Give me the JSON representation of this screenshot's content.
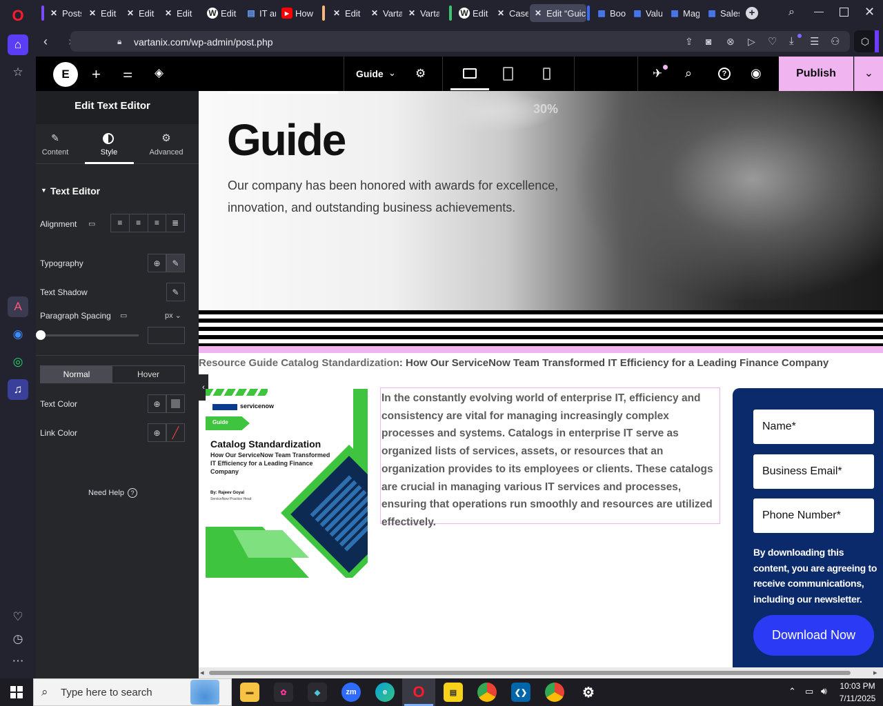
{
  "browser": {
    "tabs": [
      {
        "label": "Posts",
        "icon": "x-icon"
      },
      {
        "label": "Edit",
        "icon": "x-icon"
      },
      {
        "label": "Edit",
        "icon": "x-icon"
      },
      {
        "label": "Edit",
        "icon": "x-icon"
      },
      {
        "label": "Edit",
        "icon": "wordpress-icon"
      },
      {
        "label": "IT an",
        "icon": "page-icon"
      },
      {
        "label": "How",
        "icon": "youtube-icon"
      },
      {
        "label": "Edit",
        "icon": "x-icon"
      },
      {
        "label": "Varta",
        "icon": "x-icon"
      },
      {
        "label": "Varta",
        "icon": "x-icon"
      },
      {
        "label": "Edit",
        "icon": "wordpress-icon"
      },
      {
        "label": "Case",
        "icon": "x-icon"
      },
      {
        "label": "Edit “Guic",
        "icon": "x-icon"
      },
      {
        "label": "Boo",
        "icon": "page-icon"
      },
      {
        "label": "Valu",
        "icon": "page-icon"
      },
      {
        "label": "Mag",
        "icon": "page-icon"
      },
      {
        "label": "Sales",
        "icon": "page-icon"
      }
    ],
    "url": "vartanix.com/wp-admin/post.php"
  },
  "elementor": {
    "page_name": "Guide",
    "publish_label": "Publish"
  },
  "panel": {
    "title": "Edit Text Editor",
    "tabs": {
      "content": "Content",
      "style": "Style",
      "advanced": "Advanced"
    },
    "section_title": "Text Editor",
    "alignment_label": "Alignment",
    "typography_label": "Typography",
    "text_shadow_label": "Text Shadow",
    "paragraph_spacing_label": "Paragraph Spacing",
    "unit": "px",
    "normal_label": "Normal",
    "hover_label": "Hover",
    "text_color_label": "Text Color",
    "link_color_label": "Link Color",
    "need_help": "Need Help"
  },
  "page": {
    "hero_title": "Guide",
    "hero_text_line1": "Our company has been honored with awards for excellence,",
    "hero_text_line2": "innovation, and outstanding business achievements.",
    "hero_badge": "30%",
    "breadcrumb_prefix": "Resource Guide Catalog Standardization",
    "breadcrumb_rest": ": How Our ServiceNow Team Transformed IT Efficiency for a Leading Finance Company",
    "cover": {
      "brand": "servicenow",
      "tag": "Guide",
      "title": "Catalog Standardization",
      "subtitle_line1": "How Our ServiceNow Team Transformed",
      "subtitle_line2": "IT Efficiency for a Leading Finance",
      "subtitle_line3": "Company",
      "author": "By: Rajeev Goyal",
      "author_role": "ServiceNow Practice Head"
    },
    "body_text": "In the constantly evolving world of enterprise IT, efficiency and consistency are vital for managing increasingly complex processes and systems. Catalogs in enterprise IT serve as organized lists of services, assets, or resources that an organization provides to its employees or clients. These catalogs are crucial in managing various IT services and processes, ensuring that operations run smoothly and resources are utilized effectively.",
    "form": {
      "name_placeholder": "Name*",
      "email_placeholder": "Business Email*",
      "phone_placeholder": "Phone Number*",
      "consent_text": "By downloading this content, you are agreeing to receive communications, including our newsletter.",
      "download_label": "Download Now"
    }
  },
  "taskbar": {
    "search_placeholder": "Type here to search",
    "time": "10:03 PM",
    "date": "7/11/2025"
  },
  "colors": {
    "accent_pink": "#f0b5f0",
    "form_bg": "#0b2a6b",
    "download_btn": "#2b3bf5"
  }
}
